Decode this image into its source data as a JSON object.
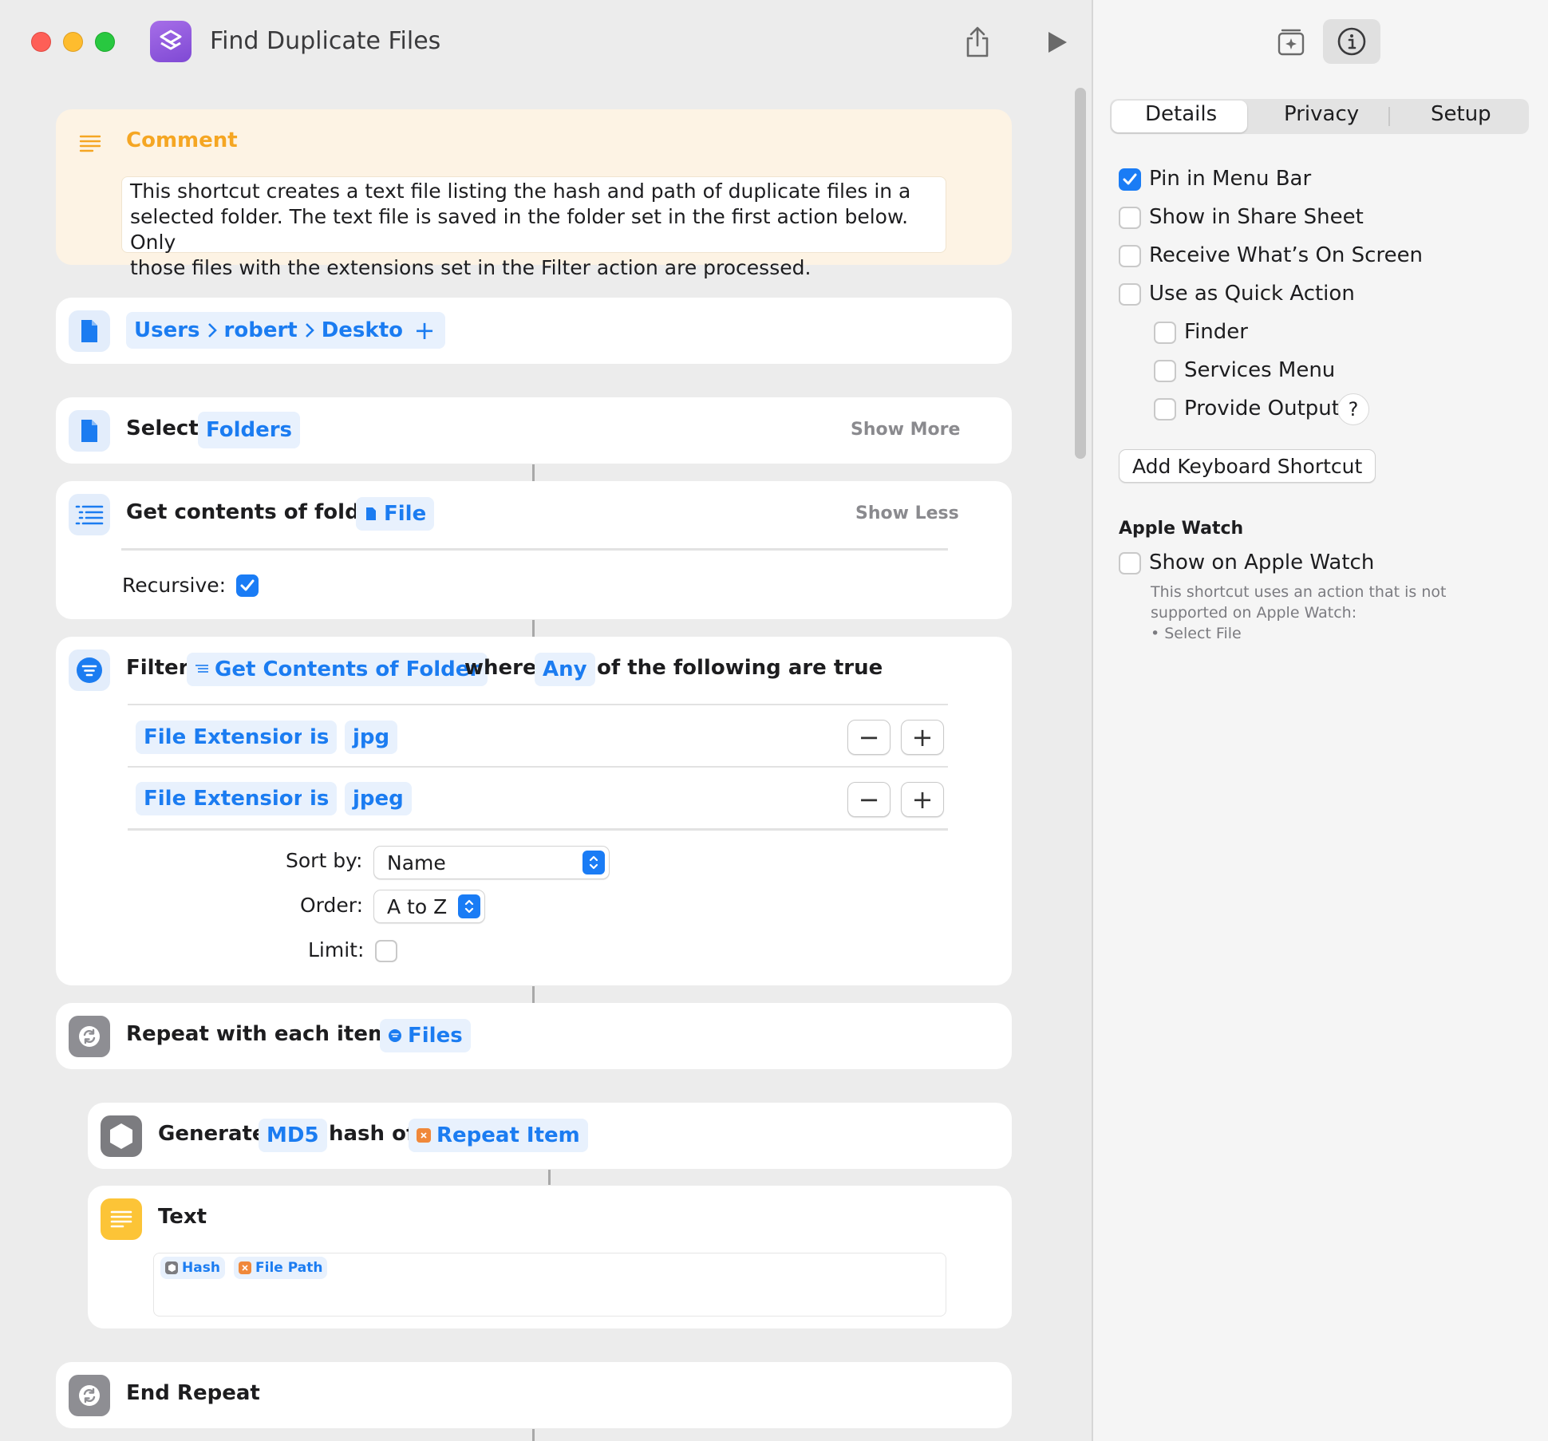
{
  "window": {
    "title": "Find Duplicate Files"
  },
  "comment": {
    "title": "Comment",
    "lines": [
      "This shortcut creates a text file listing the hash and path of duplicate files in a",
      "selected folder. The text file is saved in the folder set in the first action below. Only",
      "those files with the extensions set in the Filter action are processed."
    ]
  },
  "path_action": {
    "parts": [
      "Users",
      "robert",
      "Desktop"
    ],
    "add": "+"
  },
  "select_action": {
    "label": "Select",
    "token": "Folders",
    "show_more": "Show More"
  },
  "get_contents": {
    "label": "Get contents of folder",
    "token": "File",
    "show_less": "Show Less",
    "recursive_label": "Recursive:",
    "recursive": true
  },
  "filter": {
    "label": "Filter",
    "token": "Get Contents of Folder",
    "where": "where",
    "any": "Any",
    "tail": "of the following are true",
    "conditions": [
      {
        "field": "File Extension",
        "op": "is",
        "value": "jpg"
      },
      {
        "field": "File Extension",
        "op": "is",
        "value": "jpeg"
      }
    ],
    "minus": "−",
    "plus": "+",
    "sort_label": "Sort by:",
    "sort_value": "Name",
    "order_label": "Order:",
    "order_value": "A to Z",
    "limit_label": "Limit:"
  },
  "repeat": {
    "label": "Repeat with each item in",
    "token": "Files"
  },
  "hash": {
    "label": "Generate",
    "algo": "MD5",
    "mid": "hash of",
    "token": "Repeat Item"
  },
  "text_action": {
    "label": "Text",
    "chips": [
      "Hash",
      "File Path"
    ]
  },
  "end_repeat": {
    "label": "End Repeat"
  },
  "inspector": {
    "tabs": [
      "Details",
      "Privacy",
      "Setup"
    ],
    "options": [
      {
        "label": "Pin in Menu Bar",
        "checked": true
      },
      {
        "label": "Show in Share Sheet",
        "checked": false
      },
      {
        "label": "Receive What’s On Screen",
        "checked": false
      },
      {
        "label": "Use as Quick Action",
        "checked": false
      }
    ],
    "quick_action_sub": [
      {
        "label": "Finder",
        "checked": false
      },
      {
        "label": "Services Menu",
        "checked": false
      },
      {
        "label": "Provide Output",
        "checked": false
      }
    ],
    "help": "?",
    "keyboard_button": "Add Keyboard Shortcut",
    "watch_header": "Apple Watch",
    "watch_option": "Show on Apple Watch",
    "watch_note": [
      "This shortcut uses an action that is not",
      "supported on Apple Watch:",
      "• Select File"
    ]
  },
  "colors": {
    "accent": "#1b7cf1",
    "token_bg": "#e8f1fd",
    "comment_bg": "#fdf3e4",
    "comment_title": "#f5a623"
  }
}
